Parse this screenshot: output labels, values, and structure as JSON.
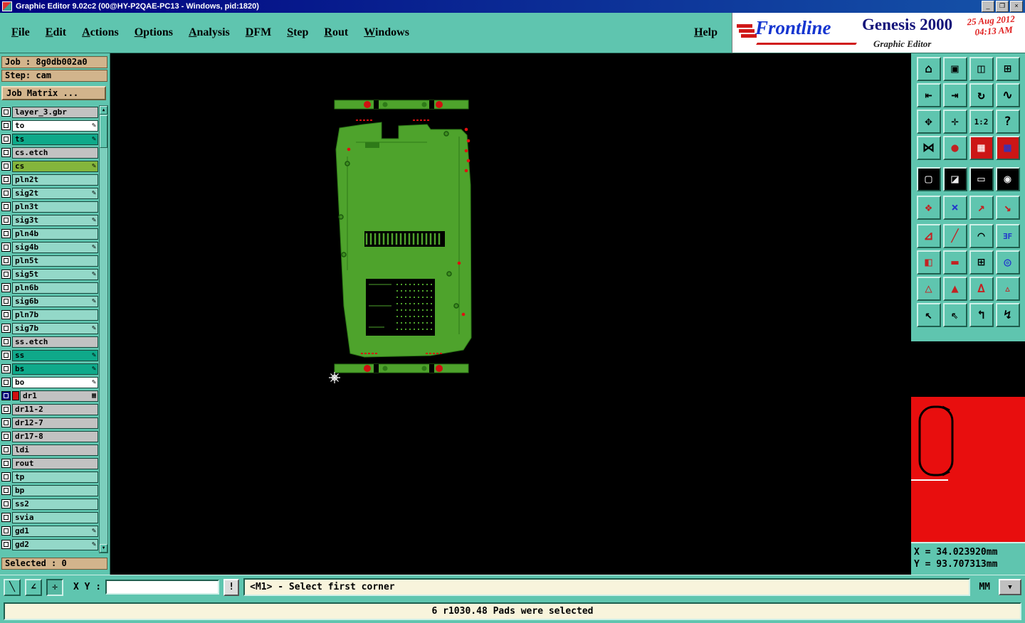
{
  "window": {
    "title": "Graphic Editor 9.02c2 (00@HY-P2QAE-PC13 - Windows, pid:1820)",
    "controls": {
      "minimize": "_",
      "maximize": "❐",
      "close": "×"
    }
  },
  "menu": {
    "items": [
      "File",
      "Edit",
      "Actions",
      "Options",
      "Analysis",
      "DFM",
      "Step",
      "Rout",
      "Windows"
    ],
    "help": "Help"
  },
  "branding": {
    "logo": "Frontline",
    "product": "Genesis 2000",
    "date": "25 Aug 2012",
    "time": "04:13 AM",
    "subtitle": "Graphic Editor"
  },
  "job_panel": {
    "job": "Job : 8g0db002a0",
    "step": "Step: cam",
    "matrix": "Job Matrix ...",
    "selected": "Selected : 0"
  },
  "layers": [
    {
      "name": "layer_3.gbr",
      "pencil": false
    },
    {
      "name": "to",
      "pencil": true
    },
    {
      "name": "ts",
      "pencil": true
    },
    {
      "name": "cs.etch",
      "pencil": false
    },
    {
      "name": "cs",
      "pencil": true
    },
    {
      "name": "pln2t",
      "pencil": false
    },
    {
      "name": "sig2t",
      "pencil": true
    },
    {
      "name": "pln3t",
      "pencil": false
    },
    {
      "name": "sig3t",
      "pencil": true
    },
    {
      "name": "pln4b",
      "pencil": false
    },
    {
      "name": "sig4b",
      "pencil": true
    },
    {
      "name": "pln5t",
      "pencil": false
    },
    {
      "name": "sig5t",
      "pencil": true
    },
    {
      "name": "pln6b",
      "pencil": false
    },
    {
      "name": "sig6b",
      "pencil": true
    },
    {
      "name": "pln7b",
      "pencil": false
    },
    {
      "name": "sig7b",
      "pencil": true
    },
    {
      "name": "ss.etch",
      "pencil": false
    },
    {
      "name": "ss",
      "pencil": true
    },
    {
      "name": "bs",
      "pencil": true
    },
    {
      "name": "bo",
      "pencil": true
    },
    {
      "name": "dr1",
      "pencil": false
    },
    {
      "name": "dr11-2",
      "pencil": false
    },
    {
      "name": "dr12-7",
      "pencil": false
    },
    {
      "name": "dr17-8",
      "pencil": false
    },
    {
      "name": "ldi",
      "pencil": false
    },
    {
      "name": "rout",
      "pencil": false
    },
    {
      "name": "tp",
      "pencil": false
    },
    {
      "name": "bp",
      "pencil": false
    },
    {
      "name": "ss2",
      "pencil": false
    },
    {
      "name": "svia",
      "pencil": false
    },
    {
      "name": "gd1",
      "pencil": true
    },
    {
      "name": "gd2",
      "pencil": true
    }
  ],
  "glyphs": {
    "pencil": "✎",
    "drill": "▦",
    "scroll_up": "▲",
    "scroll_down": "▼",
    "dropdown": "▼"
  },
  "toolbar": {
    "icons": [
      {
        "name": "home-view",
        "glyph": "⌂"
      },
      {
        "name": "screen-view",
        "glyph": "▣"
      },
      {
        "name": "window-view",
        "glyph": "◫"
      },
      {
        "name": "quad-view",
        "glyph": "⊞"
      },
      {
        "name": "pan-left",
        "glyph": "⇤"
      },
      {
        "name": "pan-right",
        "glyph": "⇥"
      },
      {
        "name": "zoom-previous",
        "glyph": "↻"
      },
      {
        "name": "wave-tool",
        "glyph": "∿"
      },
      {
        "name": "pan-tool",
        "glyph": "✥"
      },
      {
        "name": "center-view",
        "glyph": "✛"
      },
      {
        "name": "zoom-ratio",
        "glyph": "1:2"
      },
      {
        "name": "help-tool",
        "glyph": "?"
      },
      {
        "name": "measure-tool",
        "glyph": "⋈"
      },
      {
        "name": "highlight-tool",
        "glyph": "●"
      },
      {
        "name": "grid-snap",
        "glyph": "▦"
      },
      {
        "name": "grid-dots",
        "glyph": "▩"
      },
      {
        "name": "frame-capture",
        "glyph": "▢"
      },
      {
        "name": "overlay-compare",
        "glyph": "◪"
      },
      {
        "name": "ruler-tool",
        "glyph": "▭"
      },
      {
        "name": "origin-marker",
        "glyph": "◉"
      },
      {
        "name": "net-points",
        "glyph": "❖"
      },
      {
        "name": "delete-vertex",
        "glyph": "×"
      },
      {
        "name": "move-point",
        "glyph": "↗"
      },
      {
        "name": "copy-point",
        "glyph": "↘"
      },
      {
        "name": "angle-measure",
        "glyph": "⊿"
      },
      {
        "name": "line-draw",
        "glyph": "╱"
      },
      {
        "name": "arc-draw",
        "glyph": "◠"
      },
      {
        "name": "mirror-tool",
        "glyph": "ƎF"
      },
      {
        "name": "layer-swap",
        "glyph": "◧"
      },
      {
        "name": "line-width",
        "glyph": "▬"
      },
      {
        "name": "transform-box",
        "glyph": "⊞"
      },
      {
        "name": "circle-overlap",
        "glyph": "◎"
      },
      {
        "name": "triangle-outline",
        "glyph": "△"
      },
      {
        "name": "triangle-filled",
        "glyph": "▲"
      },
      {
        "name": "triangle-open",
        "glyph": "∆"
      },
      {
        "name": "triangle-small",
        "glyph": "▵"
      },
      {
        "name": "select-pointer",
        "glyph": "↖"
      },
      {
        "name": "select-corner",
        "glyph": "⇖"
      },
      {
        "name": "select-turn",
        "glyph": "↰"
      },
      {
        "name": "select-zigzag",
        "glyph": "↯"
      }
    ]
  },
  "coords": {
    "x": "X = 34.023920mm",
    "y": "Y = 93.707313mm"
  },
  "status_bar": {
    "xy_label": "X Y :",
    "input_value": "",
    "alert": "!",
    "prompt": "<M1> - Select first corner",
    "units": "MM",
    "tools": [
      {
        "name": "slope-mode",
        "glyph": "╲"
      },
      {
        "name": "angle-mode",
        "glyph": "∠"
      },
      {
        "name": "grid-mode",
        "glyph": "✛"
      }
    ]
  },
  "message_bar": {
    "text": "6 r1030.48 Pads were selected"
  },
  "colors": {
    "teal": "#5FC5AF",
    "teal_light": "#93D8C8",
    "layer_selected": "#0FA98A",
    "layer_cs": "#84B53C",
    "tan": "#D2B48C",
    "board_green": "#4EA32C",
    "drill_red": "#D01010",
    "preview_red": "#E80E0E",
    "titlebar_navy": "#000080"
  }
}
